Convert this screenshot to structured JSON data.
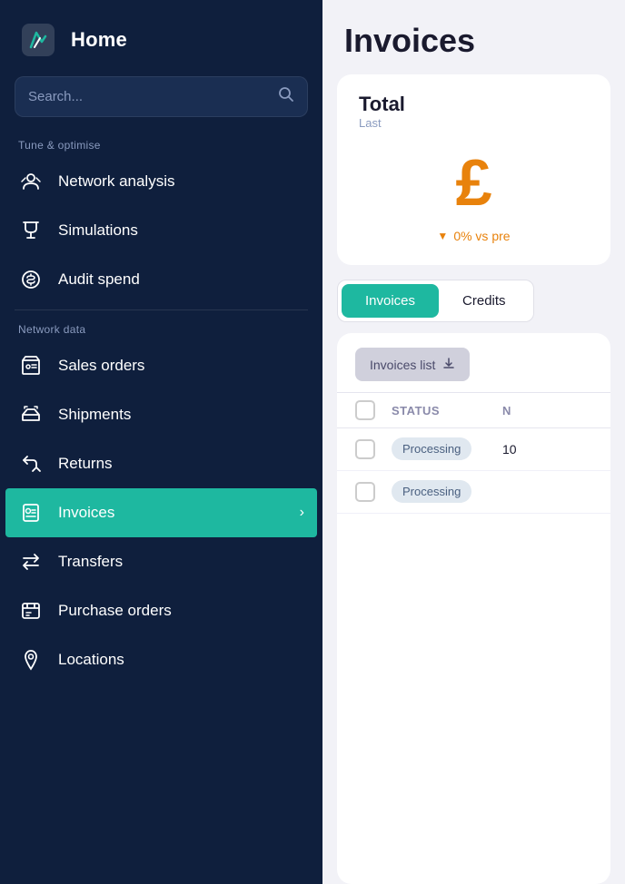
{
  "sidebar": {
    "home_label": "Home",
    "search_placeholder": "Search...",
    "sections": [
      {
        "label": "Tune & optimise",
        "items": [
          {
            "id": "network-analysis",
            "label": "Network analysis",
            "icon": "network-icon",
            "active": false
          },
          {
            "id": "simulations",
            "label": "Simulations",
            "icon": "simulations-icon",
            "active": false
          },
          {
            "id": "audit-spend",
            "label": "Audit spend",
            "icon": "audit-icon",
            "active": false
          }
        ]
      },
      {
        "label": "Network data",
        "items": [
          {
            "id": "sales-orders",
            "label": "Sales orders",
            "icon": "sales-orders-icon",
            "active": false
          },
          {
            "id": "shipments",
            "label": "Shipments",
            "icon": "shipments-icon",
            "active": false
          },
          {
            "id": "returns",
            "label": "Returns",
            "icon": "returns-icon",
            "active": false
          },
          {
            "id": "invoices",
            "label": "Invoices",
            "icon": "invoices-icon",
            "active": true
          },
          {
            "id": "transfers",
            "label": "Transfers",
            "icon": "transfers-icon",
            "active": false
          },
          {
            "id": "purchase-orders",
            "label": "Purchase orders",
            "icon": "purchase-orders-icon",
            "active": false
          },
          {
            "id": "locations",
            "label": "Locations",
            "icon": "locations-icon",
            "active": false
          }
        ]
      }
    ]
  },
  "main": {
    "page_title": "Invoices",
    "summary": {
      "title": "Total",
      "subtitle": "Last",
      "value": "£",
      "comparison": "0% vs pre"
    },
    "tabs": [
      {
        "id": "invoices-tab",
        "label": "Invoices",
        "active": true
      },
      {
        "id": "credits-tab",
        "label": "Credits",
        "active": false
      }
    ],
    "table": {
      "toolbar_label": "Invoices list",
      "download_icon": "download-icon",
      "columns": [
        {
          "id": "status-col",
          "label": "Status"
        },
        {
          "id": "number-col",
          "label": "N"
        }
      ],
      "rows": [
        {
          "status": "Processing",
          "number": "10"
        },
        {
          "status": "Processing",
          "number": ""
        }
      ]
    }
  }
}
